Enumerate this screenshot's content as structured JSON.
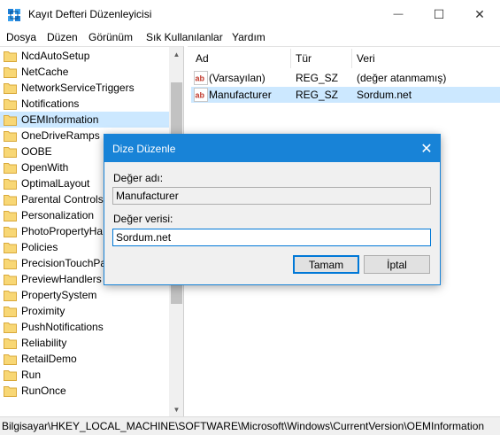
{
  "window": {
    "title": "Kayıt Defteri Düzenleyicisi",
    "controls": {
      "minimize": "—",
      "maximize": "☐",
      "close": "✕"
    }
  },
  "menu": [
    "Dosya",
    "Düzen",
    "Görünüm",
    "Sık Kullanılanlar",
    "Yardım"
  ],
  "tree": {
    "items": [
      {
        "label": "NcdAutoSetup",
        "selected": false
      },
      {
        "label": "NetCache",
        "selected": false
      },
      {
        "label": "NetworkServiceTriggers",
        "selected": false
      },
      {
        "label": "Notifications",
        "selected": false
      },
      {
        "label": "OEMInformation",
        "selected": true
      },
      {
        "label": "OneDriveRamps",
        "selected": false
      },
      {
        "label": "OOBE",
        "selected": false
      },
      {
        "label": "OpenWith",
        "selected": false
      },
      {
        "label": "OptimalLayout",
        "selected": false
      },
      {
        "label": "Parental Controls",
        "selected": false
      },
      {
        "label": "Personalization",
        "selected": false
      },
      {
        "label": "PhotoPropertyHa",
        "selected": false
      },
      {
        "label": "Policies",
        "selected": false
      },
      {
        "label": "PrecisionTouchPa",
        "selected": false
      },
      {
        "label": "PreviewHandlers",
        "selected": false
      },
      {
        "label": "PropertySystem",
        "selected": false
      },
      {
        "label": "Proximity",
        "selected": false
      },
      {
        "label": "PushNotifications",
        "selected": false
      },
      {
        "label": "Reliability",
        "selected": false
      },
      {
        "label": "RetailDemo",
        "selected": false
      },
      {
        "label": "Run",
        "selected": false
      },
      {
        "label": "RunOnce",
        "selected": false
      }
    ]
  },
  "list": {
    "columns": [
      "Ad",
      "Tür",
      "Veri"
    ],
    "rows": [
      {
        "name": "(Varsayılan)",
        "type": "REG_SZ",
        "data": "(değer atanmamış)",
        "selected": false
      },
      {
        "name": "Manufacturer",
        "type": "REG_SZ",
        "data": "Sordum.net",
        "selected": true
      }
    ]
  },
  "statusbar": {
    "path": "Bilgisayar\\HKEY_LOCAL_MACHINE\\SOFTWARE\\Microsoft\\Windows\\CurrentVersion\\OEMInformation"
  },
  "dialog": {
    "title": "Dize Düzenle",
    "close": "✕",
    "name_label": "Değer adı:",
    "name_value": "Manufacturer",
    "data_label": "Değer verisi:",
    "data_value": "Sordum.net",
    "ok_label": "Tamam",
    "cancel_label": "İptal"
  },
  "colors": {
    "selection": "#cce8ff",
    "dialog_titlebar": "#1883d7",
    "folder": "#f8d775"
  }
}
